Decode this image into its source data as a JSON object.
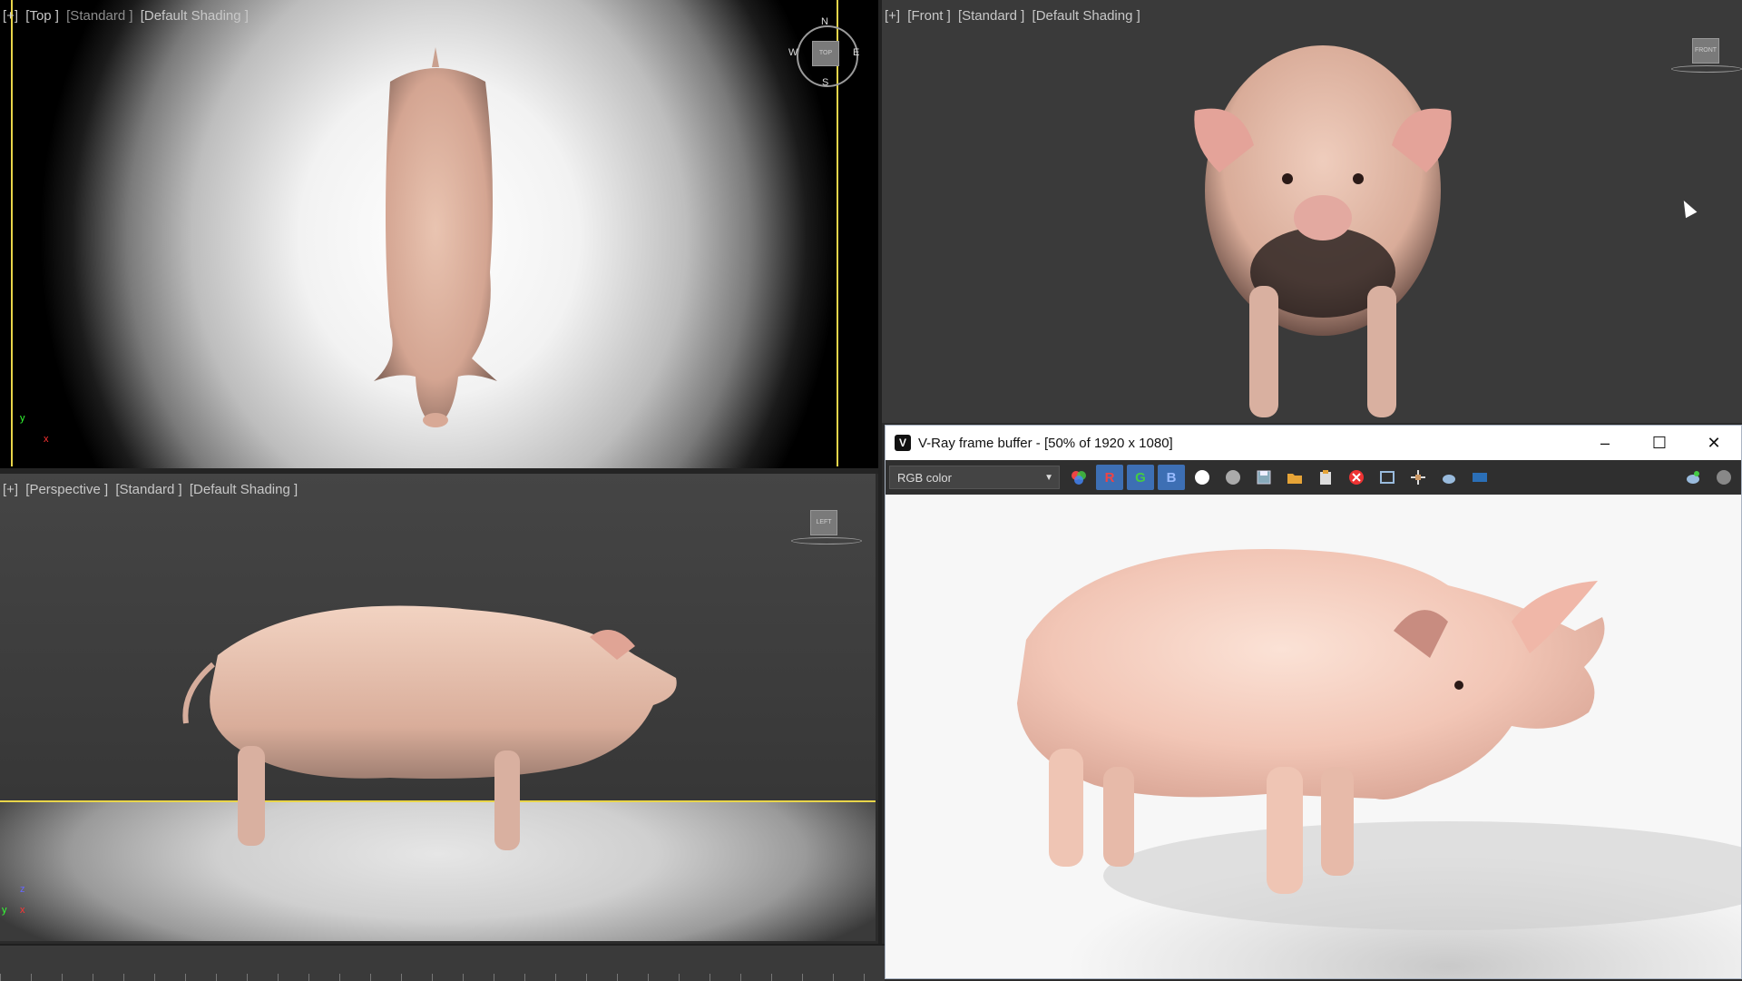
{
  "viewports": {
    "top": {
      "label": [
        "[+]",
        "[Top ]",
        "[Standard ]",
        "[Default Shading ]"
      ],
      "compass": {
        "n": "N",
        "s": "S",
        "e": "E",
        "w": "W",
        "cube": "TOP"
      }
    },
    "front": {
      "label": [
        "[+]",
        "[Front ]",
        "[Standard ]",
        "[Default Shading ]"
      ],
      "cube": "FRONT"
    },
    "perspective": {
      "label": [
        "[+]",
        "[Perspective ]",
        "[Standard ]",
        "[Default Shading ]"
      ],
      "cube": "LEFT"
    }
  },
  "vfb": {
    "title": "V-Ray frame buffer - [50% of 1920 x 1080]",
    "app_icon": "V",
    "minimize": "–",
    "maximize": "☐",
    "close": "✕",
    "channel": "RGB color",
    "channel_r": "R",
    "channel_g": "G",
    "channel_b": "B"
  },
  "axes": {
    "x": "x",
    "y": "y",
    "z": "z"
  },
  "colors": {
    "viewport_active": "#e9d54a",
    "vfb_select": "#3d6fb4"
  }
}
